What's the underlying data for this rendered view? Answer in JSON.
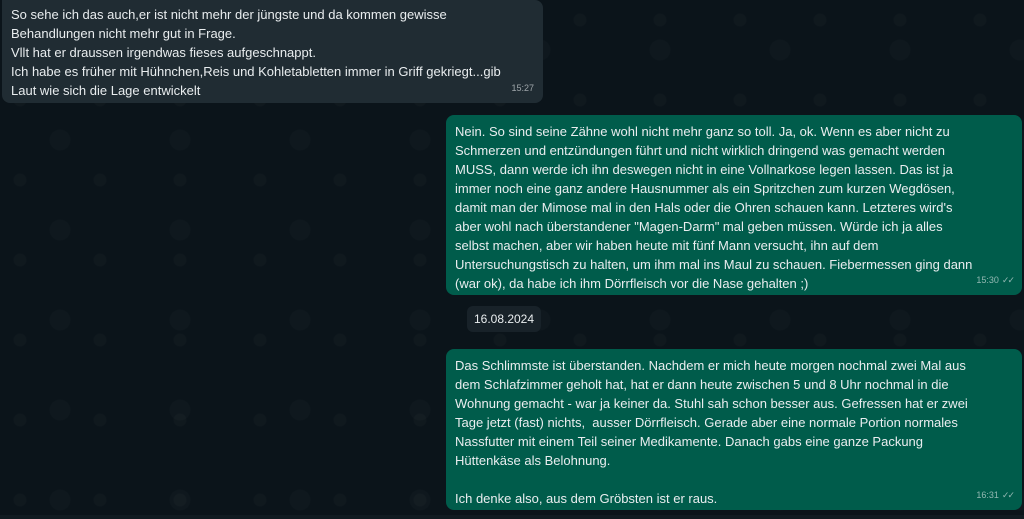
{
  "messages": [
    {
      "direction": "incoming",
      "text": "So sehe ich das auch,er ist nicht mehr der jüngste und da kommen gewisse\nBehandlungen nicht mehr gut in Frage.\nVllt hat er draussen irgendwas fieses aufgeschnappt.\nIch habe es früher mit Hühnchen,Reis und Kohletabletten immer in Griff gekriegt...gib\nLaut wie sich die Lage entwickelt",
      "time": "15:27"
    },
    {
      "direction": "outgoing",
      "text": "Nein. So sind seine Zähne wohl nicht mehr ganz so toll. Ja, ok. Wenn es aber nicht zu\nSchmerzen und entzündungen führt und nicht wirklich dringend was gemacht werden\nMUSS, dann werde ich ihn deswegen nicht in eine Vollnarkose legen lassen. Das ist ja\nimmer noch eine ganz andere Hausnummer als ein Spritzchen zum kurzen Wegdösen,\ndamit man der Mimose mal in den Hals oder die Ohren schauen kann. Letzteres wird's\naber wohl nach überstandener \"Magen-Darm\" mal geben müssen. Würde ich ja alles\nselbst machen, aber wir haben heute mit fünf Mann versucht, ihn auf dem\nUntersuchungstisch zu halten, um ihm mal ins Maul zu schauen. Fiebermessen ging dann\n(war ok), da habe ich ihm Dörrfleisch vor die Nase gehalten ;)",
      "time": "15:30",
      "ticks": "✓✓"
    },
    {
      "direction": "outgoing",
      "text": "Das Schlimmste ist überstanden. Nachdem er mich heute morgen nochmal zwei Mal aus\ndem Schlafzimmer geholt hat, hat er dann heute zwischen 5 und 8 Uhr nochmal in die\nWohnung gemacht - war ja keiner da. Stuhl sah schon besser aus. Gefressen hat er zwei\nTage jetzt (fast) nichts,  ausser Dörrfleisch. Gerade aber eine normale Portion normales\nNassfutter mit einem Teil seiner Medikamente. Danach gabs eine ganze Packung\nHüttenkäse als Belohnung.\n\nIch denke also, aus dem Gröbsten ist er raus.",
      "time": "16:31",
      "ticks": "✓✓"
    }
  ],
  "date_separator": "16.08.2024",
  "colors": {
    "background": "#0b141a",
    "incoming_bubble": "#202c33",
    "outgoing_bubble": "#005c4b",
    "text": "#e9edef"
  }
}
